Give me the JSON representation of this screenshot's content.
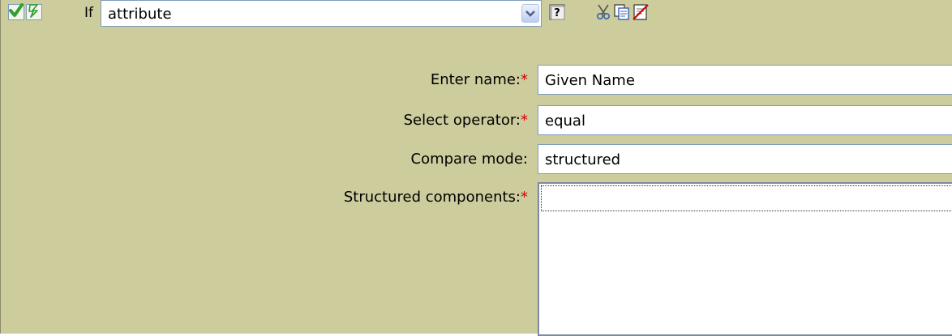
{
  "header": {
    "if_label": "If",
    "condition_select": {
      "value": "attribute"
    },
    "icons": [
      "check-icon",
      "lightning-icon",
      "help-icon",
      "cut-icon",
      "copy-icon",
      "delete-icon"
    ]
  },
  "form": {
    "enter_name": {
      "label": "Enter name:",
      "required_mark": "*",
      "value": "Given Name"
    },
    "select_operator": {
      "label": "Select operator:",
      "required_mark": "*",
      "value": "equal"
    },
    "compare_mode": {
      "label": "Compare mode:",
      "value": "structured"
    },
    "structured_components": {
      "label": "Structured components:",
      "required_mark": "*",
      "value": ""
    }
  },
  "colors": {
    "panel_bg": "#cccc9d",
    "field_border": "#7f9db9",
    "required": "#d00000",
    "check_green": "#2ea02e"
  }
}
